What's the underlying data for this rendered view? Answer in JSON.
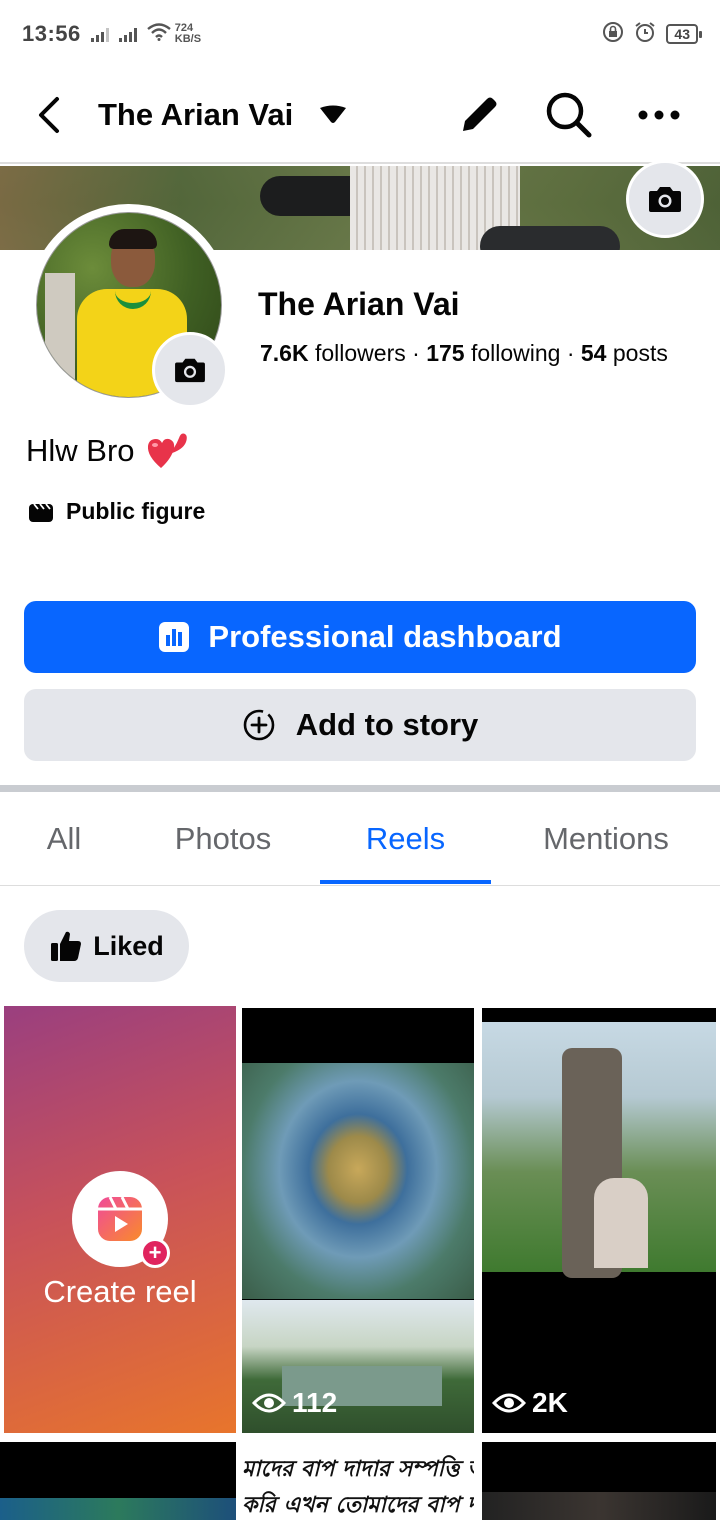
{
  "status_bar": {
    "time": "13:56",
    "net_speed_value": "724",
    "net_speed_unit": "KB/S",
    "battery": "43"
  },
  "header": {
    "title": "The Arian Vai"
  },
  "profile": {
    "name": "The Arian Vai",
    "followers_count": "7.6K",
    "followers_label": " followers · ",
    "following_count": "175",
    "following_label": " following · ",
    "posts_count": "54",
    "posts_label": " posts",
    "bio": "Hlw Bro",
    "category": "Public figure"
  },
  "actions": {
    "dashboard_label": "Professional dashboard",
    "add_story_label": "Add to story"
  },
  "tabs": [
    {
      "label": "All",
      "active": false
    },
    {
      "label": "Photos",
      "active": false
    },
    {
      "label": "Reels",
      "active": true
    },
    {
      "label": "Mentions",
      "active": false
    }
  ],
  "filter_chip": "Liked",
  "reels": {
    "create_label": "Create reel",
    "items": [
      {
        "views": "112"
      },
      {
        "views": "2K"
      }
    ],
    "partial_caption_line1": "মাদের বাপ দাদার সম্পত্তি আ",
    "partial_caption_line2": "করি এখন তোমাদের বাপ দাদা"
  },
  "colors": {
    "accent": "#0866ff",
    "secondary_button": "#e4e6eb",
    "muted_text": "#65676b"
  }
}
